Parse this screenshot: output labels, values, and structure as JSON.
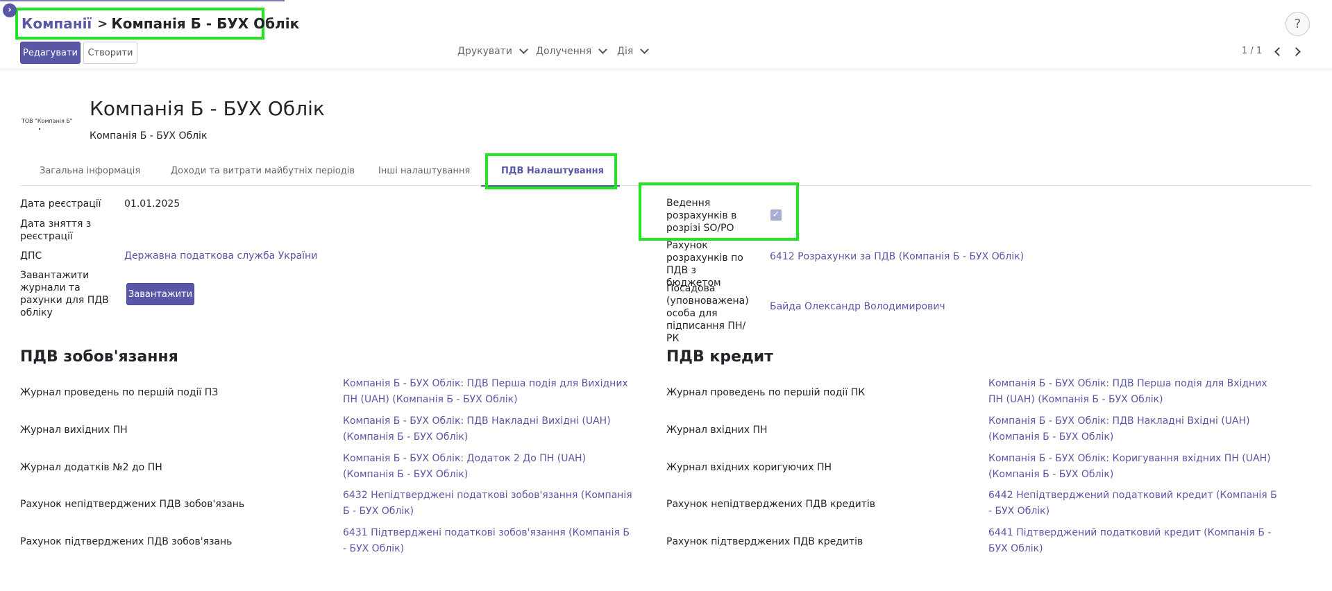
{
  "breadcrumb": {
    "parent": "Компанії",
    "separator": ">",
    "current": "Компанія Б - БУХ Облік"
  },
  "toolbar": {
    "edit_label": "Редагувати",
    "create_label": "Створити"
  },
  "dropdowns": {
    "print": "Друкувати",
    "attach": "Долучення",
    "action": "Дія"
  },
  "pager": {
    "value": "1 / 1"
  },
  "help": {
    "label": "?"
  },
  "record": {
    "logo_text": "ТОВ \"Компанія Б\"",
    "name": "Компанія Б - БУХ Облік",
    "subtitle": "Компанія Б - БУХ Облік"
  },
  "tabs": [
    {
      "label": "Загальна інформація"
    },
    {
      "label": "Доходи та витрати майбутніх періодів"
    },
    {
      "label": "Інші налаштування"
    },
    {
      "label": "ПДВ Налаштування"
    }
  ],
  "left_fields": {
    "reg_date_label": "Дата реєстрації",
    "reg_date_value": "01.01.2025",
    "dereg_label": "Дата зняття з реєстрації",
    "dps_label": "ДПС",
    "dps_value": "Державна податкова служба України",
    "upload_label": "Завантажити журнали та рахунки для ПДВ обліку",
    "upload_button": "Завантажити"
  },
  "right_fields": {
    "so_po_label": "Ведення розрахунків в розрізі SO/PO",
    "so_po_checked": true,
    "account_label": "Рахунок розрахунків по ПДВ з бюджетом",
    "account_value": "6412 Розрахунки за ПДВ (Компанія Б - БУХ Облік)",
    "official_label": "Посадова (уповноважена) особа для підписання ПН/РК",
    "official_value": "Байда Олександр Володимирович"
  },
  "vat_liabilities": {
    "title": "ПДВ зобов'язання",
    "rows": [
      {
        "label": "Журнал проведень по першій події ПЗ",
        "value": "Компанія Б - БУХ Облік: ПДВ Перша подія для Вихідних ПН (UAH) (Компанія Б - БУХ Облік)"
      },
      {
        "label": "Журнал вихідних ПН",
        "value": "Компанія Б - БУХ Облік: ПДВ Накладні Вихідні (UAH) (Компанія Б - БУХ Облік)"
      },
      {
        "label": "Журнал додатків №2 до ПН",
        "value": "Компанія Б - БУХ Облік: Додаток 2 До ПН (UAH) (Компанія Б - БУХ Облік)"
      },
      {
        "label": "Рахунок непідтверджених ПДВ зобов'язань",
        "value": "6432 Непідтверджені податкові зобов'язання (Компанія Б - БУХ Облік)"
      },
      {
        "label": "Рахунок підтверджених ПДВ зобов'язань",
        "value": "6431 Підтверджені податкові зобов'язання (Компанія Б - БУХ Облік)"
      }
    ]
  },
  "vat_credit": {
    "title": "ПДВ кредит",
    "rows": [
      {
        "label": "Журнал проведень по першій події ПК",
        "value": "Компанія Б - БУХ Облік: ПДВ Перша подія для Вхідних ПН (UAH) (Компанія Б - БУХ Облік)"
      },
      {
        "label": "Журнал вхідних ПН",
        "value": "Компанія Б - БУХ Облік: ПДВ Накладні Вхідні (UAH) (Компанія Б - БУХ Облік)"
      },
      {
        "label": "Журнал вхідних коригуючих ПН",
        "value": "Компанія Б - БУХ Облік: Коригування вхідних ПН (UAH) (Компанія Б - БУХ Облік)"
      },
      {
        "label": "Рахунок непідтверджених ПДВ кредитів",
        "value": "6442 Непідтверджений податковий кредит (Компанія Б - БУХ Облік)"
      },
      {
        "label": "Рахунок підтверджених ПДВ кредитів",
        "value": "6441 Підтверджений податковий кредит (Компанія Б - БУХ Облік)"
      }
    ]
  },
  "colors": {
    "accent": "#5a57a6",
    "highlight": "#22e522"
  }
}
